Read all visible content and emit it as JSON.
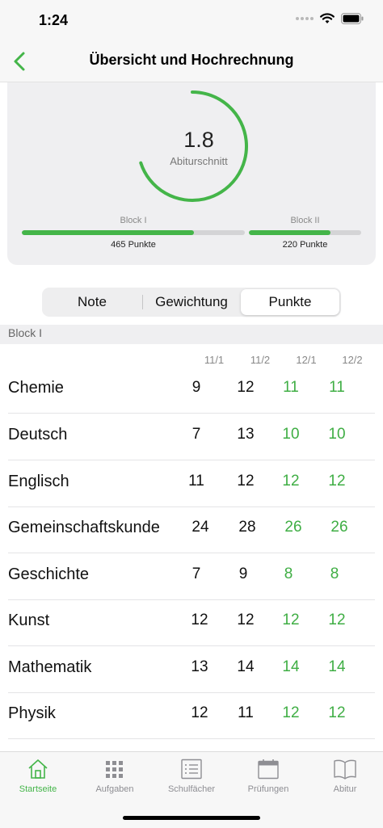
{
  "status_bar": {
    "time": "1:24",
    "icons": [
      "signal-dots-icon",
      "wifi-icon",
      "battery-icon"
    ]
  },
  "nav": {
    "title": "Übersicht und Hochrechnung",
    "back_icon": "chevron-left-icon"
  },
  "summary": {
    "average_value": "1.8",
    "average_label": "Abiturschnitt",
    "gauge_fraction": 0.7,
    "block1": {
      "label": "Block I",
      "points": "465 Punkte",
      "fraction": 0.77
    },
    "block2": {
      "label": "Block II",
      "points": "220 Punkte",
      "fraction": 0.73
    }
  },
  "segmented": {
    "options": [
      "Note",
      "Gewichtung",
      "Punkte"
    ],
    "selected": "Punkte"
  },
  "section": {
    "title": "Block I",
    "columns": [
      "11/1",
      "11/2",
      "12/1",
      "12/2"
    ]
  },
  "subjects": [
    {
      "name": "Chemie",
      "values": [
        "9",
        "12",
        "11",
        "11"
      ]
    },
    {
      "name": "Deutsch",
      "values": [
        "7",
        "13",
        "10",
        "10"
      ]
    },
    {
      "name": "Englisch",
      "values": [
        "11",
        "12",
        "12",
        "12"
      ]
    },
    {
      "name": "Gemeinschaftskunde",
      "values": [
        "24",
        "28",
        "26",
        "26"
      ]
    },
    {
      "name": "Geschichte",
      "values": [
        "7",
        "9",
        "8",
        "8"
      ]
    },
    {
      "name": "Kunst",
      "values": [
        "12",
        "12",
        "12",
        "12"
      ]
    },
    {
      "name": "Mathematik",
      "values": [
        "13",
        "14",
        "14",
        "14"
      ]
    },
    {
      "name": "Physik",
      "values": [
        "12",
        "11",
        "12",
        "12"
      ]
    }
  ],
  "tab_bar": {
    "tabs": [
      {
        "label": "Startseite",
        "icon": "house-icon",
        "active": true
      },
      {
        "label": "Aufgaben",
        "icon": "grid-icon",
        "active": false
      },
      {
        "label": "Schulfächer",
        "icon": "list-icon",
        "active": false
      },
      {
        "label": "Prüfungen",
        "icon": "calendar-icon",
        "active": false
      },
      {
        "label": "Abitur",
        "icon": "book-icon",
        "active": false
      }
    ]
  },
  "colors": {
    "accent": "#44b549",
    "projected_value": "#3fae44",
    "inactive_tab": "#8e8e93",
    "card_background": "#efeff1"
  }
}
